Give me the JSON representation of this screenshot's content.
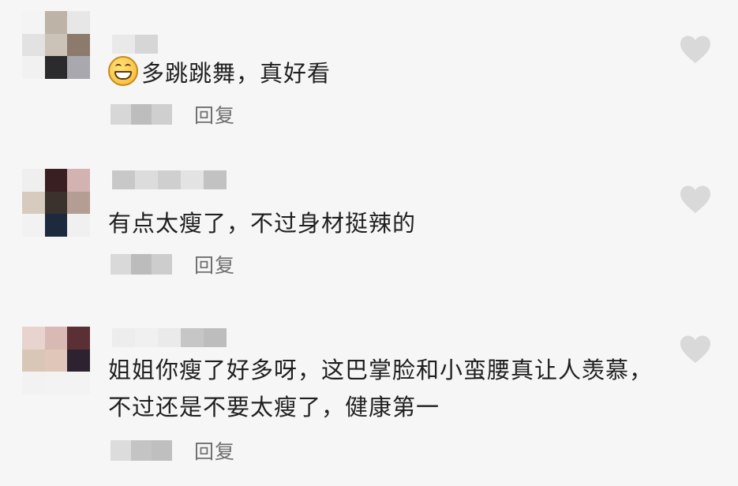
{
  "comments": [
    {
      "avatar_colors": [
        "#f4f4f4",
        "#bdb3a6",
        "#e7e7e7",
        "#e2e2e2",
        "#cbc3b8",
        "#8c7b6c",
        "#f1f1f1",
        "#2b2a2d",
        "#a8a8ae"
      ],
      "username_blur": [
        "#e9e9e9",
        "#d6d6d6"
      ],
      "text": "多跳跳舞，真好看",
      "emoji": "grinning-face",
      "meta_blur": [
        "#d7d7d7",
        "#bdbdbd",
        "#cfcfcf"
      ],
      "reply_label": "回复",
      "liked": false
    },
    {
      "avatar_colors": [
        "#efefef",
        "#3a1f22",
        "#d3b2b2",
        "#d7cbbd",
        "#3b322d",
        "#b49d93",
        "#f2f2f2",
        "#1d2a3d",
        "#f0f0f0"
      ],
      "username_blur": [
        "#c8c8c8",
        "#dcdcdc",
        "#cfcfcf",
        "#e3e3e3",
        "#c2c2c2"
      ],
      "text": "有点太瘦了，不过身材挺辣的",
      "emoji": "",
      "meta_blur": [
        "#d9d9d9",
        "#bcbcbc",
        "#cdcdcd"
      ],
      "reply_label": "回复",
      "liked": false
    },
    {
      "avatar_colors": [
        "#e8d3cf",
        "#d9b9b3",
        "#5a3035",
        "#d8c7b6",
        "#e0c6b8",
        "#2d2230",
        "#f2f2f2",
        "#f3f3f3",
        "#f3f3f3"
      ],
      "username_blur": [
        "#ededed",
        "#f0f0f0",
        "#eaeaea",
        "#c6c6c6",
        "#bdbdbd"
      ],
      "text": "姐姐你瘦了好多呀，这巴掌脸和小蛮腰真让人羡慕，不过还是不要太瘦了，健康第一",
      "emoji": "",
      "meta_blur": [
        "#dcdcdc",
        "#c4c4c4",
        "#bfbfbf"
      ],
      "reply_label": "回复",
      "liked": false
    }
  ],
  "heart_color": "#d9d9d9"
}
